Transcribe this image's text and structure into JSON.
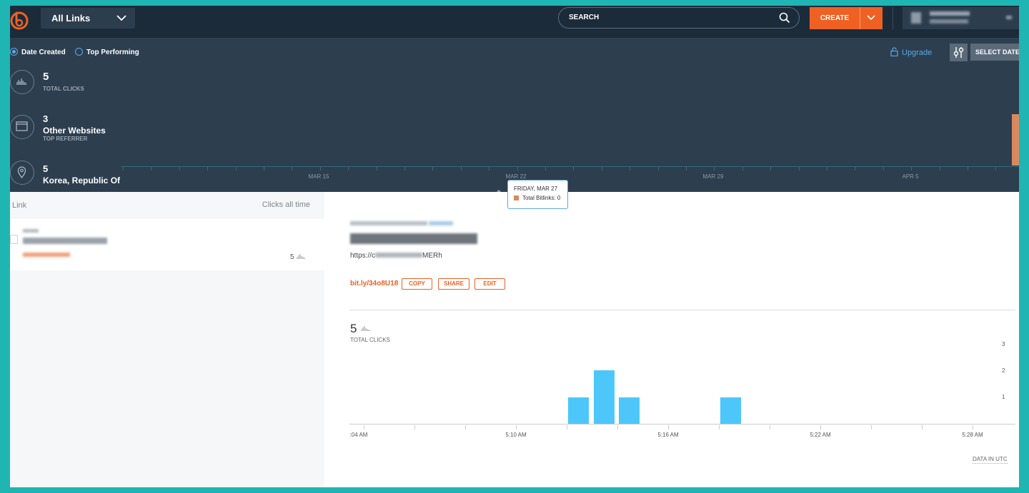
{
  "topbar": {
    "links_select": "All Links",
    "search_label": "SEARCH",
    "create_label": "CREATE"
  },
  "filters": {
    "date_created": "Date Created",
    "top_performing": "Top Performing",
    "selected": "Date Created",
    "upgrade": "Upgrade",
    "select_date": "SELECT DATE"
  },
  "stats": {
    "total_clicks_value": "5",
    "total_clicks_label": "TOTAL CLICKS",
    "referrer_value": "3",
    "referrer_name": "Other Websites",
    "referrer_label": "TOP REFERRER",
    "location_value": "5",
    "location_name": "Korea, Republic Of"
  },
  "timeline": {
    "labels": [
      "MAR 15",
      "MAR 22",
      "MAR 29",
      "APR 5"
    ]
  },
  "tooltip": {
    "date": "FRIDAY, MAR 27",
    "series": "Total Bitlinks: 0",
    "color": "#d88a5c"
  },
  "link_list": {
    "col_link": "Link",
    "col_clicks": "Clicks all time",
    "items": [
      {
        "clicks": "5"
      }
    ]
  },
  "detail": {
    "url_visible": "https://c",
    "url_tail": "MERh",
    "short_link": "bit.ly/34o8U18",
    "copy": "COPY",
    "share": "SHARE",
    "edit": "EDIT",
    "total_clicks_value": "5",
    "total_clicks_label": "TOTAL CLICKS",
    "data_note": "DATA IN UTC"
  },
  "chart_data": {
    "type": "bar",
    "x_ticks": [
      ":04 AM",
      "5:10 AM",
      "5:16 AM",
      "5:22 AM",
      "5:28 AM"
    ],
    "x_tick_minutes": [
      4,
      10,
      16,
      22,
      28
    ],
    "bar_minutes": [
      12,
      13,
      14,
      18
    ],
    "values": [
      1,
      2,
      1,
      1
    ],
    "ylim": [
      0,
      3
    ],
    "y_ticks": [
      "1",
      "2",
      "3"
    ],
    "color": "#4dc7f9",
    "grid": false
  }
}
